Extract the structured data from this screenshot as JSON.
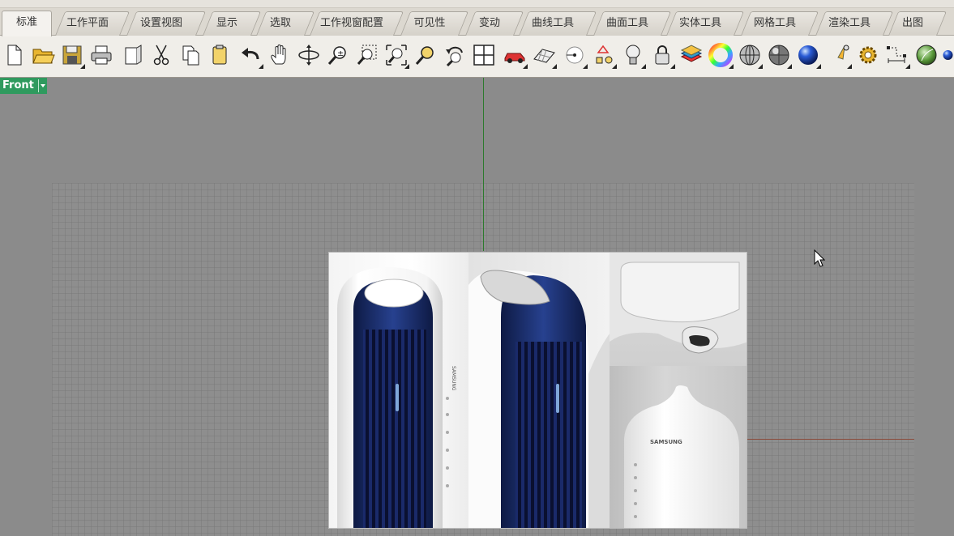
{
  "tabs": [
    {
      "label": "标准",
      "active": true
    },
    {
      "label": "工作平面"
    },
    {
      "label": "设置视图"
    },
    {
      "label": "显示"
    },
    {
      "label": "选取"
    },
    {
      "label": "工作视窗配置"
    },
    {
      "label": "可见性"
    },
    {
      "label": "变动"
    },
    {
      "label": "曲线工具"
    },
    {
      "label": "曲面工具"
    },
    {
      "label": "实体工具"
    },
    {
      "label": "网格工具"
    },
    {
      "label": "渲染工具"
    },
    {
      "label": "出图"
    }
  ],
  "toolbar": {
    "icons": [
      "new-file-icon",
      "open-folder-icon",
      "save-icon",
      "print-icon",
      "page-setup-icon",
      "cut-icon",
      "copy-icon",
      "paste-icon",
      "undo-icon",
      "pan-hand-icon",
      "rotate-view-icon",
      "zoom-icon",
      "zoom-window-icon",
      "zoom-extents-icon",
      "zoom-selected-icon",
      "undo-view-icon",
      "viewport-layout-icon",
      "car-icon",
      "grid-plane-icon",
      "point-object-icon",
      "object-snap-icon",
      "light-bulb-icon",
      "lock-icon",
      "layer-icon",
      "color-wheel-icon",
      "sphere-wireframe-icon",
      "sphere-shaded-icon",
      "sphere-render-icon",
      "spotlight-icon",
      "settings-gear-icon",
      "dimension-icon",
      "render-preview-icon",
      "blue-sphere-icon"
    ]
  },
  "viewport": {
    "name": "Front",
    "reference_image": {
      "brand_text": "SAMSUNG",
      "side_brand_text": "SAMSUNG"
    }
  },
  "colors": {
    "viewport_label_bg": "#2f9a5e",
    "axis_y": "#2c7a2c",
    "axis_x": "#8a4a3a",
    "product_blue": "#1c2f6e"
  }
}
